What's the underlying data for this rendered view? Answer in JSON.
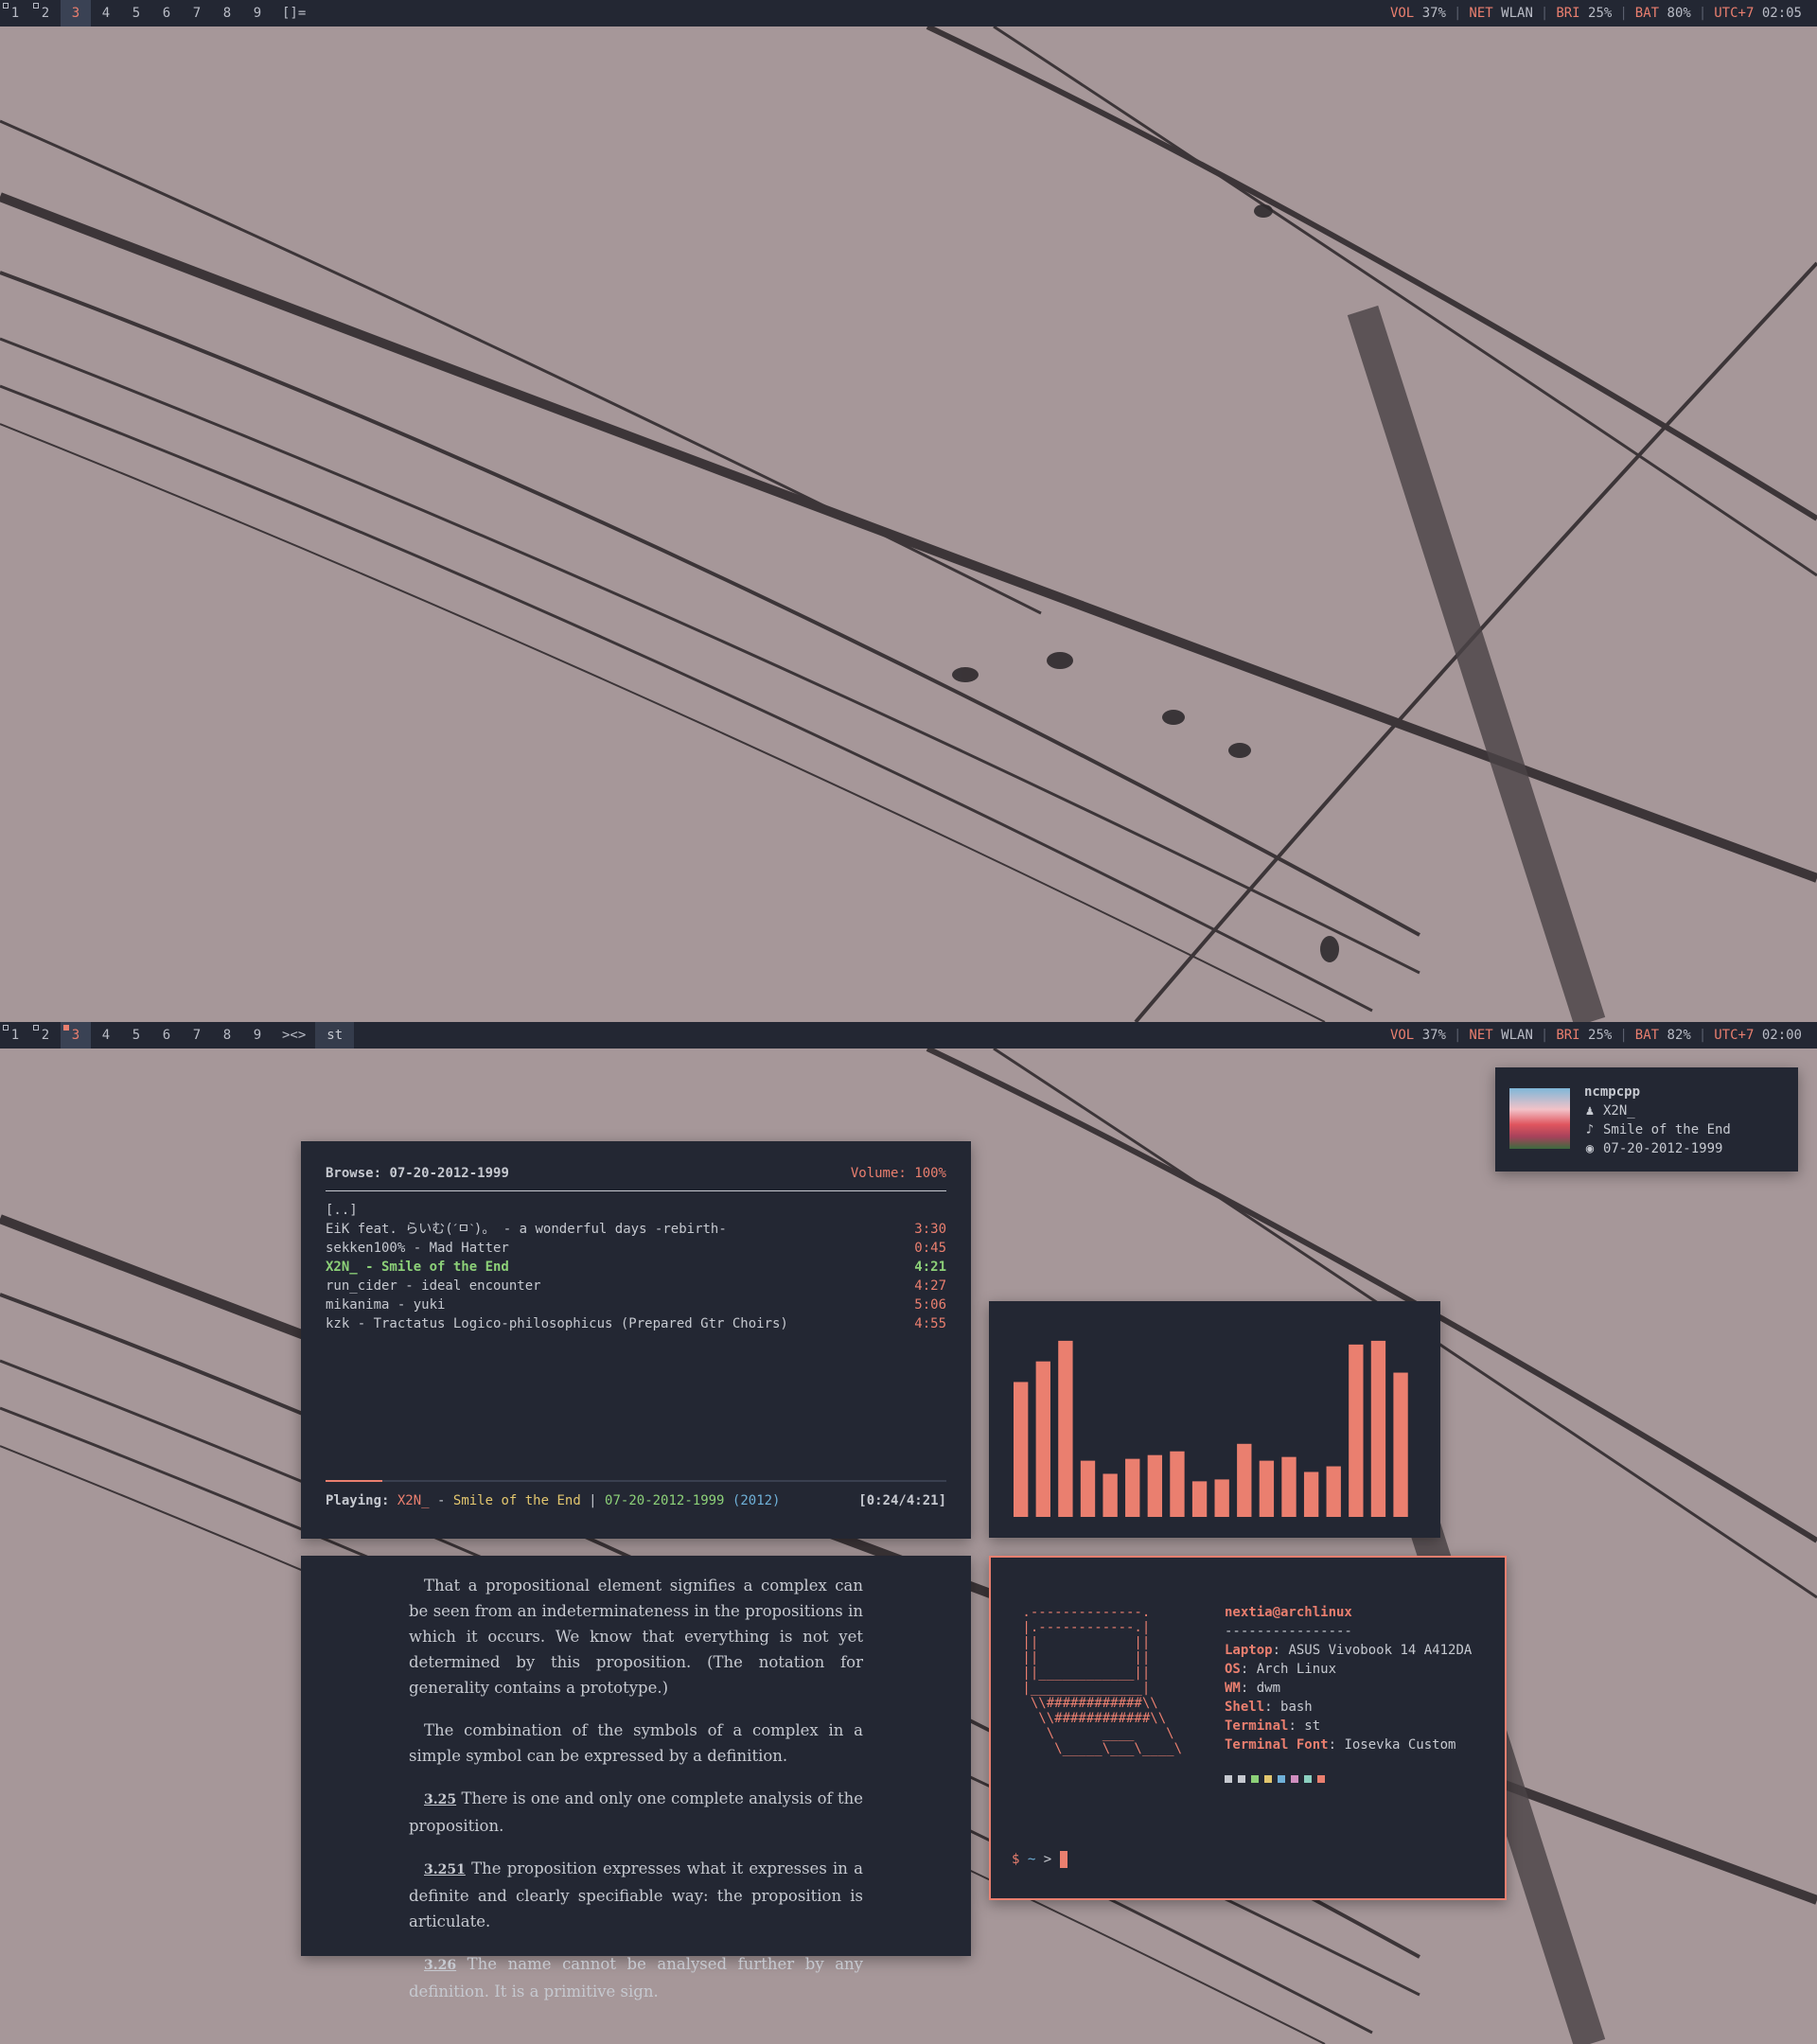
{
  "screens": [
    {
      "tags": [
        "1",
        "2",
        "3",
        "4",
        "5",
        "6",
        "7",
        "8",
        "9"
      ],
      "layout": "[]=",
      "window_title": "",
      "status": [
        {
          "key": "VOL",
          "val": "37%"
        },
        {
          "key": "NET",
          "val": "WLAN"
        },
        {
          "key": "BRI",
          "val": "25%"
        },
        {
          "key": "BAT",
          "val": "80%"
        },
        {
          "key": "UTC+7",
          "val": "02:05"
        }
      ]
    },
    {
      "tags": [
        "1",
        "2",
        "3",
        "4",
        "5",
        "6",
        "7",
        "8",
        "9"
      ],
      "layout": "><>",
      "window_title": "st",
      "status": [
        {
          "key": "VOL",
          "val": "37%"
        },
        {
          "key": "NET",
          "val": "WLAN"
        },
        {
          "key": "BRI",
          "val": "25%"
        },
        {
          "key": "BAT",
          "val": "82%"
        },
        {
          "key": "UTC+7",
          "val": "02:00"
        }
      ]
    }
  ],
  "ncmpcpp": {
    "browse_label": "Browse:",
    "browse_path": "07-20-2012-1999",
    "volume": "Volume: 100%",
    "parent": "[..]",
    "tracks": [
      {
        "name": "EiK feat. らいむ(ˊㅁˋ)。 - a wonderful days -rebirth-",
        "dur": "3:30"
      },
      {
        "name": "sekken100% - Mad Hatter",
        "dur": "0:45"
      },
      {
        "name": "X2N_ - Smile of the End",
        "dur": "4:21"
      },
      {
        "name": "run_cider - ideal encounter",
        "dur": "4:27"
      },
      {
        "name": "mikanima - yuki",
        "dur": "5:06"
      },
      {
        "name": "kzk - Tractatus Logico-philosophicus (Prepared Gtr Choirs)",
        "dur": "4:55"
      }
    ],
    "current_index": 2,
    "playing_label": "Playing:",
    "np_artist": "X2N_",
    "np_dash": " - ",
    "np_title": "Smile of the End",
    "np_sep": " | ",
    "np_album": "07-20-2012-1999",
    "np_year": " (2012)",
    "time": "[0:24/4:21]",
    "progress": 0.092
  },
  "visualizer": {
    "bars": [
      0.72,
      0.83,
      0.94,
      0.3,
      0.23,
      0.31,
      0.33,
      0.35,
      0.19,
      0.2,
      0.39,
      0.3,
      0.32,
      0.24,
      0.27,
      0.92,
      0.94,
      0.77
    ],
    "color": "#ea7f6f"
  },
  "zathura": {
    "paragraphs": [
      {
        "num": "",
        "text": "That a propositional element signifies a complex can be seen from an indeterminateness in the propositions in which it occurs. We know that everything is not yet determined by this proposition. (The notation for generality contains a prototype.)"
      },
      {
        "num": "",
        "text": "The combination of the symbols of a complex in a simple symbol can be expressed by a definition."
      },
      {
        "num": "3.25",
        "text": "There is one and only one complete analysis of the proposition."
      },
      {
        "num": "3.251",
        "text": "The proposition expresses what it expresses in a definite and clearly specifiable way: the proposition is articulate."
      },
      {
        "num": "3.26",
        "text": "The name cannot be analysed further by any definition. It is a primitive sign."
      }
    ]
  },
  "fetch": {
    "art": " .--------------.\n |.------------.|\n ||            ||\n ||            ||\n ||____________||\n |______________|\n  \\\\############\\\\\n   \\\\############\\\\\n    \\      ____    \\\n     \\_____\\___\\____\\",
    "user": "nextia@archlinux",
    "rule": "----------------",
    "fields": [
      {
        "key": "Laptop",
        "val": "ASUS Vivobook 14 A412DA"
      },
      {
        "key": "OS",
        "val": "Arch Linux"
      },
      {
        "key": "WM",
        "val": "dwm"
      },
      {
        "key": "Shell",
        "val": "bash"
      },
      {
        "key": "Terminal",
        "val": "st"
      },
      {
        "key": "Terminal Font",
        "val": "Iosevka Custom"
      }
    ],
    "palette": [
      "#c6c9d0",
      "#c6c9d0",
      "#8cd078",
      "#e2c66e",
      "#6fb0d8",
      "#d08ec0",
      "#8cd0c0",
      "#ea7f6f"
    ],
    "prompt_dollar": "$",
    "prompt_tilde": "~",
    "prompt_arrow": ">"
  },
  "notification": {
    "title": "ncmpcpp",
    "artist": "X2N_",
    "song": "Smile of the End",
    "album": "07-20-2012-1999"
  }
}
